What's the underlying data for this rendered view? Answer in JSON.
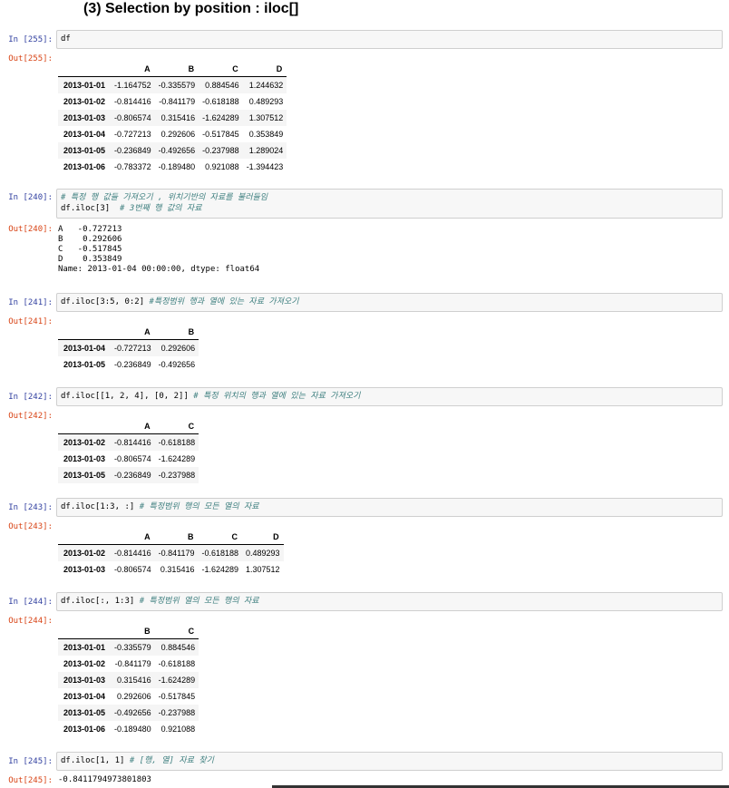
{
  "heading": "(3) Selection by position : iloc[]",
  "cells": [
    {
      "in_prompt": "In [255]:",
      "code": "df",
      "comment": "",
      "out_prompt": "Out[255]:",
      "table": {
        "columns": [
          "A",
          "B",
          "C",
          "D"
        ],
        "rows": [
          {
            "index": "2013-01-01",
            "values": [
              "-1.164752",
              "-0.335579",
              "0.884546",
              "1.244632"
            ]
          },
          {
            "index": "2013-01-02",
            "values": [
              "-0.814416",
              "-0.841179",
              "-0.618188",
              "0.489293"
            ]
          },
          {
            "index": "2013-01-03",
            "values": [
              "-0.806574",
              "0.315416",
              "-1.624289",
              "1.307512"
            ]
          },
          {
            "index": "2013-01-04",
            "values": [
              "-0.727213",
              "0.292606",
              "-0.517845",
              "0.353849"
            ]
          },
          {
            "index": "2013-01-05",
            "values": [
              "-0.236849",
              "-0.492656",
              "-0.237988",
              "1.289024"
            ]
          },
          {
            "index": "2013-01-06",
            "values": [
              "-0.783372",
              "-0.189480",
              "0.921088",
              "-1.394423"
            ]
          }
        ]
      }
    },
    {
      "in_prompt": "In [240]:",
      "code_line1_comment": "# 특정 행 값들 가져오기 , 위치기반의 자료를 불러들임",
      "code_line2": "df.iloc[3]",
      "code_line2_comment": "  # 3번째 행 값의 자료",
      "out_prompt": "Out[240]:",
      "text_lines": [
        "A   -0.727213",
        "B    0.292606",
        "C   -0.517845",
        "D    0.353849",
        "Name: 2013-01-04 00:00:00, dtype: float64"
      ]
    },
    {
      "in_prompt": "In [241]:",
      "code": "df.iloc[3:5, 0:2]",
      "comment": " #특정범위 행과 열에 있는 자료 가져오기",
      "out_prompt": "Out[241]:",
      "table": {
        "columns": [
          "A",
          "B"
        ],
        "rows": [
          {
            "index": "2013-01-04",
            "values": [
              "-0.727213",
              "0.292606"
            ]
          },
          {
            "index": "2013-01-05",
            "values": [
              "-0.236849",
              "-0.492656"
            ]
          }
        ]
      }
    },
    {
      "in_prompt": "In [242]:",
      "code": "df.iloc[[1, 2, 4], [0, 2]]",
      "comment": " # 특정 위치의 행과 열에 있는 자료 가져오기",
      "out_prompt": "Out[242]:",
      "table": {
        "columns": [
          "A",
          "C"
        ],
        "rows": [
          {
            "index": "2013-01-02",
            "values": [
              "-0.814416",
              "-0.618188"
            ]
          },
          {
            "index": "2013-01-03",
            "values": [
              "-0.806574",
              "-1.624289"
            ]
          },
          {
            "index": "2013-01-05",
            "values": [
              "-0.236849",
              "-0.237988"
            ]
          }
        ]
      }
    },
    {
      "in_prompt": "In [243]:",
      "code": "df.iloc[1:3, :]",
      "comment": " # 특정범위 행의 모든 열의 자료",
      "out_prompt": "Out[243]:",
      "table": {
        "columns": [
          "A",
          "B",
          "C",
          "D"
        ],
        "rows": [
          {
            "index": "2013-01-02",
            "values": [
              "-0.814416",
              "-0.841179",
              "-0.618188",
              "0.489293"
            ]
          },
          {
            "index": "2013-01-03",
            "values": [
              "-0.806574",
              "0.315416",
              "-1.624289",
              "1.307512"
            ]
          }
        ]
      }
    },
    {
      "in_prompt": "In [244]:",
      "code": "df.iloc[:, 1:3]",
      "comment": " # 특정범위 열의 모든 행의 자료",
      "out_prompt": "Out[244]:",
      "table": {
        "columns": [
          "B",
          "C"
        ],
        "rows": [
          {
            "index": "2013-01-01",
            "values": [
              "-0.335579",
              "0.884546"
            ]
          },
          {
            "index": "2013-01-02",
            "values": [
              "-0.841179",
              "-0.618188"
            ]
          },
          {
            "index": "2013-01-03",
            "values": [
              "0.315416",
              "-1.624289"
            ]
          },
          {
            "index": "2013-01-04",
            "values": [
              "0.292606",
              "-0.517845"
            ]
          },
          {
            "index": "2013-01-05",
            "values": [
              "-0.492656",
              "-0.237988"
            ]
          },
          {
            "index": "2013-01-06",
            "values": [
              "-0.189480",
              "0.921088"
            ]
          }
        ]
      }
    },
    {
      "in_prompt": "In [245]:",
      "code": "df.iloc[1, 1]",
      "comment": " # [행, 열] 자료 찾기",
      "out_prompt": "Out[245]:",
      "text_value": "-0.8411794973801803"
    }
  ]
}
